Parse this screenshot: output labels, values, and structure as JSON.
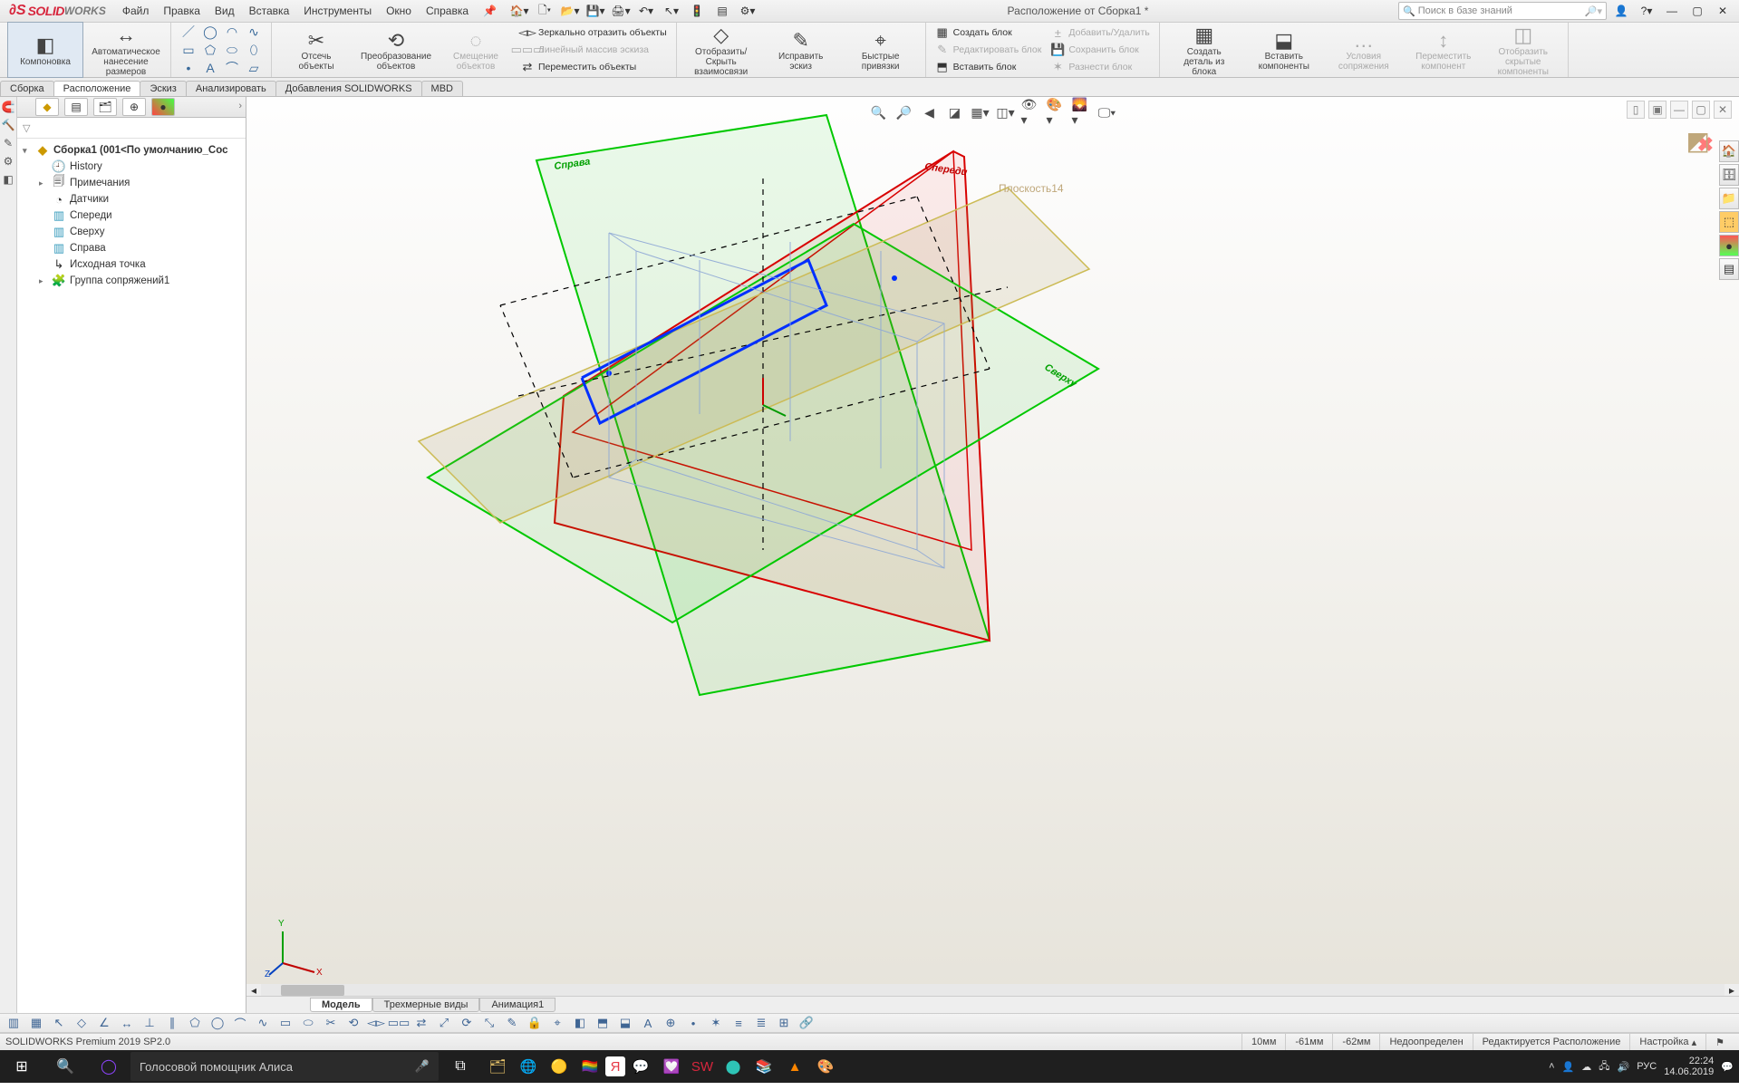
{
  "app": {
    "name": "SOLIDWORKS",
    "doc_title": "Расположение от Сборка1 *"
  },
  "menu": [
    "Файл",
    "Правка",
    "Вид",
    "Вставка",
    "Инструменты",
    "Окно",
    "Справка"
  ],
  "search": {
    "placeholder": "Поиск в базе знаний"
  },
  "ribbon": {
    "big": [
      {
        "id": "komponovka",
        "label": "Компоновка",
        "icon": "◧"
      },
      {
        "id": "avto",
        "label": "Автоматическое\nнанесение размеров",
        "icon": "↔"
      },
      {
        "id": "otsech",
        "label": "Отсечь\nобъекты",
        "icon": "✂"
      },
      {
        "id": "preobr",
        "label": "Преобразование\nобъектов",
        "icon": "⟲"
      },
      {
        "id": "smesh",
        "label": "Смещение\nобъектов",
        "icon": "◌",
        "dis": true
      },
      {
        "id": "otobr",
        "label": "Отобразить/Скрыть\nвзаимосвязи",
        "icon": "◇"
      },
      {
        "id": "isprav",
        "label": "Исправить\nэскиз",
        "icon": "✎"
      },
      {
        "id": "bystr",
        "label": "Быстрые\nпривязки",
        "icon": "⌖"
      },
      {
        "id": "sozdat",
        "label": "Создать\nдеталь из\nблока",
        "icon": "▦"
      },
      {
        "id": "vstav",
        "label": "Вставить\nкомпоненты",
        "icon": "⬓"
      },
      {
        "id": "uslov",
        "label": "Условия\nсопряжения",
        "icon": "…",
        "dis": true
      },
      {
        "id": "perem",
        "label": "Переместить\nкомпонент",
        "icon": "↕",
        "dis": true
      },
      {
        "id": "skryt",
        "label": "Отобразить\nскрытые\nкомпоненты",
        "icon": "◫",
        "dis": true
      }
    ],
    "cols": [
      {
        "items": [
          {
            "label": "Зеркально отразить объекты",
            "icon": "◅▻"
          },
          {
            "label": "Линейный массив эскиза",
            "icon": "▭▭▭",
            "dis": true
          },
          {
            "label": "Переместить объекты",
            "icon": "⇄"
          }
        ]
      },
      {
        "items": [
          {
            "label": "Создать блок",
            "icon": "▦"
          },
          {
            "label": "Редактировать блок",
            "icon": "✎",
            "dis": true
          },
          {
            "label": "Вставить блок",
            "icon": "⬒"
          }
        ]
      },
      {
        "items": [
          {
            "label": "Добавить/Удалить",
            "icon": "±",
            "dis": true
          },
          {
            "label": "Сохранить блок",
            "icon": "💾",
            "dis": true
          },
          {
            "label": "Разнести блок",
            "icon": "✶",
            "dis": true
          }
        ]
      }
    ]
  },
  "doc_tabs": [
    "Сборка",
    "Расположение",
    "Эскиз",
    "Анализировать",
    "Добавления SOLIDWORKS",
    "MBD"
  ],
  "doc_tabs_active": 1,
  "tree": {
    "root": "Сборка1  (001<По умолчанию_Сос",
    "items": [
      {
        "icon": "🕘",
        "label": "History"
      },
      {
        "icon": "🗐",
        "label": "Примечания"
      },
      {
        "icon": "◔",
        "label": "Датчики"
      },
      {
        "icon": "▥",
        "label": "Спереди"
      },
      {
        "icon": "▥",
        "label": "Сверху"
      },
      {
        "icon": "▥",
        "label": "Справа"
      },
      {
        "icon": "↳",
        "label": "Исходная точка"
      },
      {
        "icon": "🧩",
        "label": "Группа сопряжений1"
      }
    ]
  },
  "planes": {
    "front": "Спереди",
    "top": "Сверху",
    "right": "Справа",
    "extra": "Плоскость14"
  },
  "bottom_tabs": [
    "Модель",
    "Трехмерные виды",
    "Анимация1"
  ],
  "status": {
    "version": "SOLIDWORKS Premium 2019 SP2.0",
    "unit": "10мм",
    "coordX": "-61мм",
    "coordY": "-62мм",
    "state": "Недоопределен",
    "mode": "Редактируется Расположение",
    "custom": "Настройка"
  },
  "taskbar": {
    "search": "Голосовой помощник Алиса",
    "time": "22:24",
    "date": "14.06.2019",
    "lang": "РУС"
  }
}
